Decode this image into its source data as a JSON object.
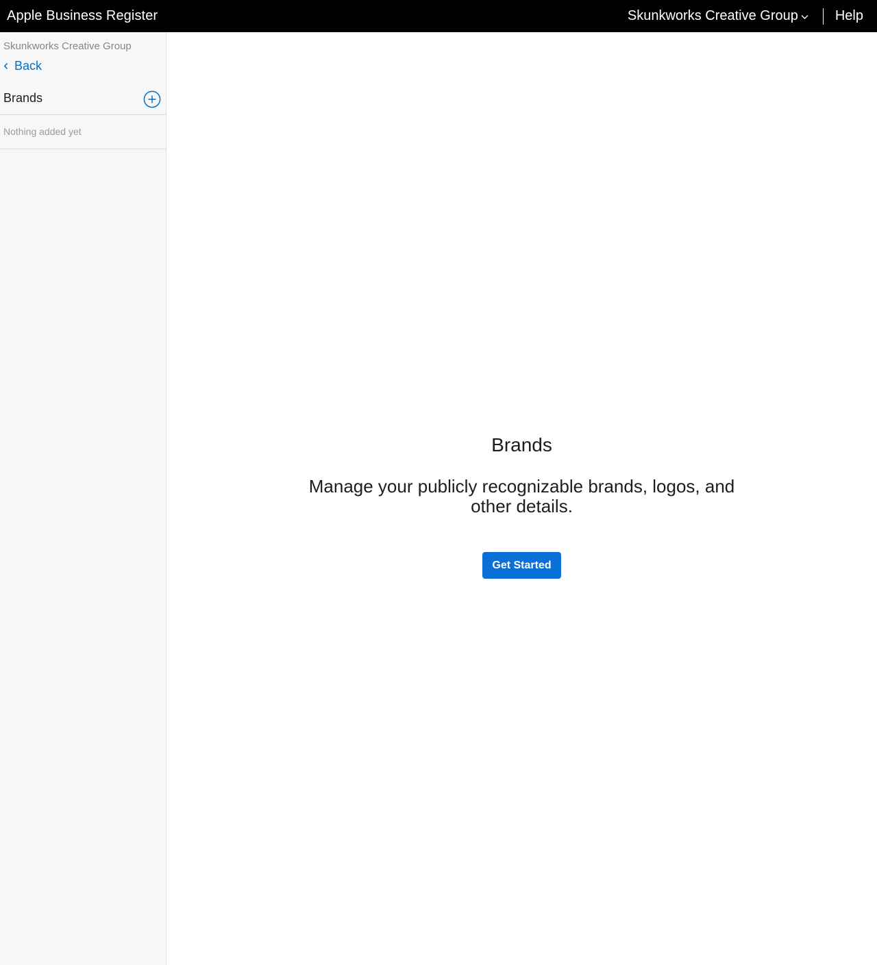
{
  "header": {
    "app_title": "Apple Business Register",
    "org_name": "Skunkworks Creative Group",
    "org_icon": "chevron-down-icon",
    "help_label": "Help"
  },
  "sidebar": {
    "org_name": "Skunkworks Creative Group",
    "back_label": "Back",
    "back_icon": "chevron-left-icon",
    "section_title": "Brands",
    "add_icon": "plus-circle-icon",
    "empty_text": "Nothing added yet"
  },
  "main": {
    "title": "Brands",
    "description": "Manage your publicly recognizable brands, logos, and other details.",
    "cta_label": "Get Started"
  },
  "colors": {
    "header_bg": "#000000",
    "sidebar_bg": "#f7f7f7",
    "link": "#0070c9",
    "primary_button": "#0a6fd6"
  }
}
